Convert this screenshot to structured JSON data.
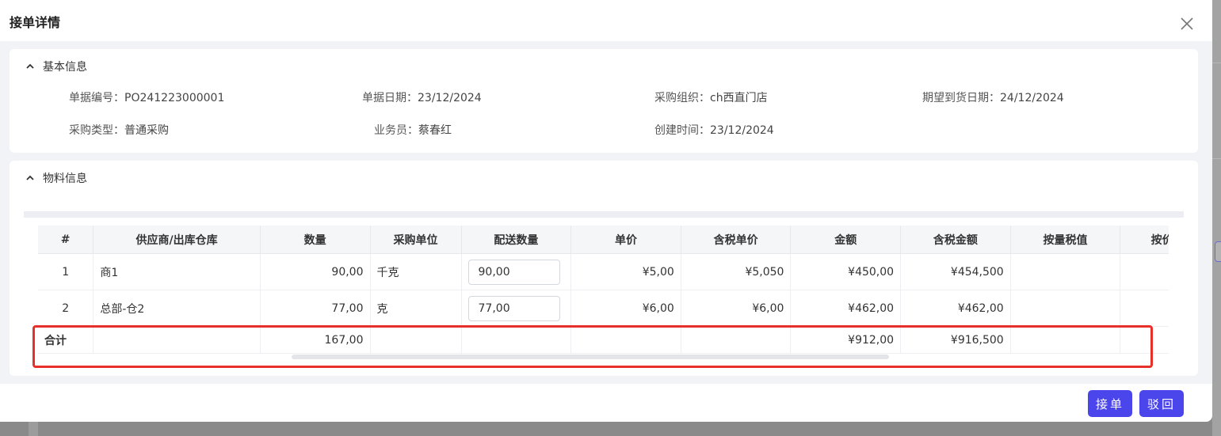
{
  "modal": {
    "title": "接单详情"
  },
  "basic_info": {
    "section_title": "基本信息",
    "doc_no_label": "单据编号：",
    "doc_no": "PO241223000001",
    "doc_date_label": "单据日期：",
    "doc_date": "23/12/2024",
    "purchase_org_label": "采购组织：",
    "purchase_org": "ch西直门店",
    "expected_date_label": "期望到货日期：",
    "expected_date": "24/12/2024",
    "purchase_type_label": "采购类型：",
    "purchase_type": "普通采购",
    "salesperson_label": "业务员：",
    "salesperson": "蔡春红",
    "created_label": "创建时间：",
    "created": "23/12/2024"
  },
  "material_info": {
    "section_title": "物料信息",
    "columns": [
      "#",
      "供应商/出库仓库",
      "数量",
      "采购单位",
      "配送数量",
      "单价",
      "含税单价",
      "金额",
      "含税金额",
      "按量税值",
      "按价税率"
    ],
    "rows": [
      {
        "no": "1",
        "supplier": "商1",
        "qty": "90,00",
        "unit": "千克",
        "delivery_qty": "90,00",
        "price": "¥5,00",
        "tax_price": "¥5,050",
        "amount": "¥450,00",
        "tax_amount": "¥454,500",
        "qty_tax": "",
        "price_tax_rate": ""
      },
      {
        "no": "2",
        "supplier": "总部-仓2",
        "qty": "77,00",
        "unit": "克",
        "delivery_qty": "77,00",
        "price": "¥6,00",
        "tax_price": "¥6,00",
        "amount": "¥462,00",
        "tax_amount": "¥462,00",
        "qty_tax": "",
        "price_tax_rate": ""
      }
    ],
    "total": {
      "label": "合计",
      "qty": "167,00",
      "amount": "¥912,00",
      "tax_amount": "¥916,500"
    }
  },
  "footer": {
    "accept_label": "接单",
    "reject_label": "驳回"
  },
  "colors": {
    "primary": "#4b45ec",
    "highlight": "#e8302a"
  }
}
